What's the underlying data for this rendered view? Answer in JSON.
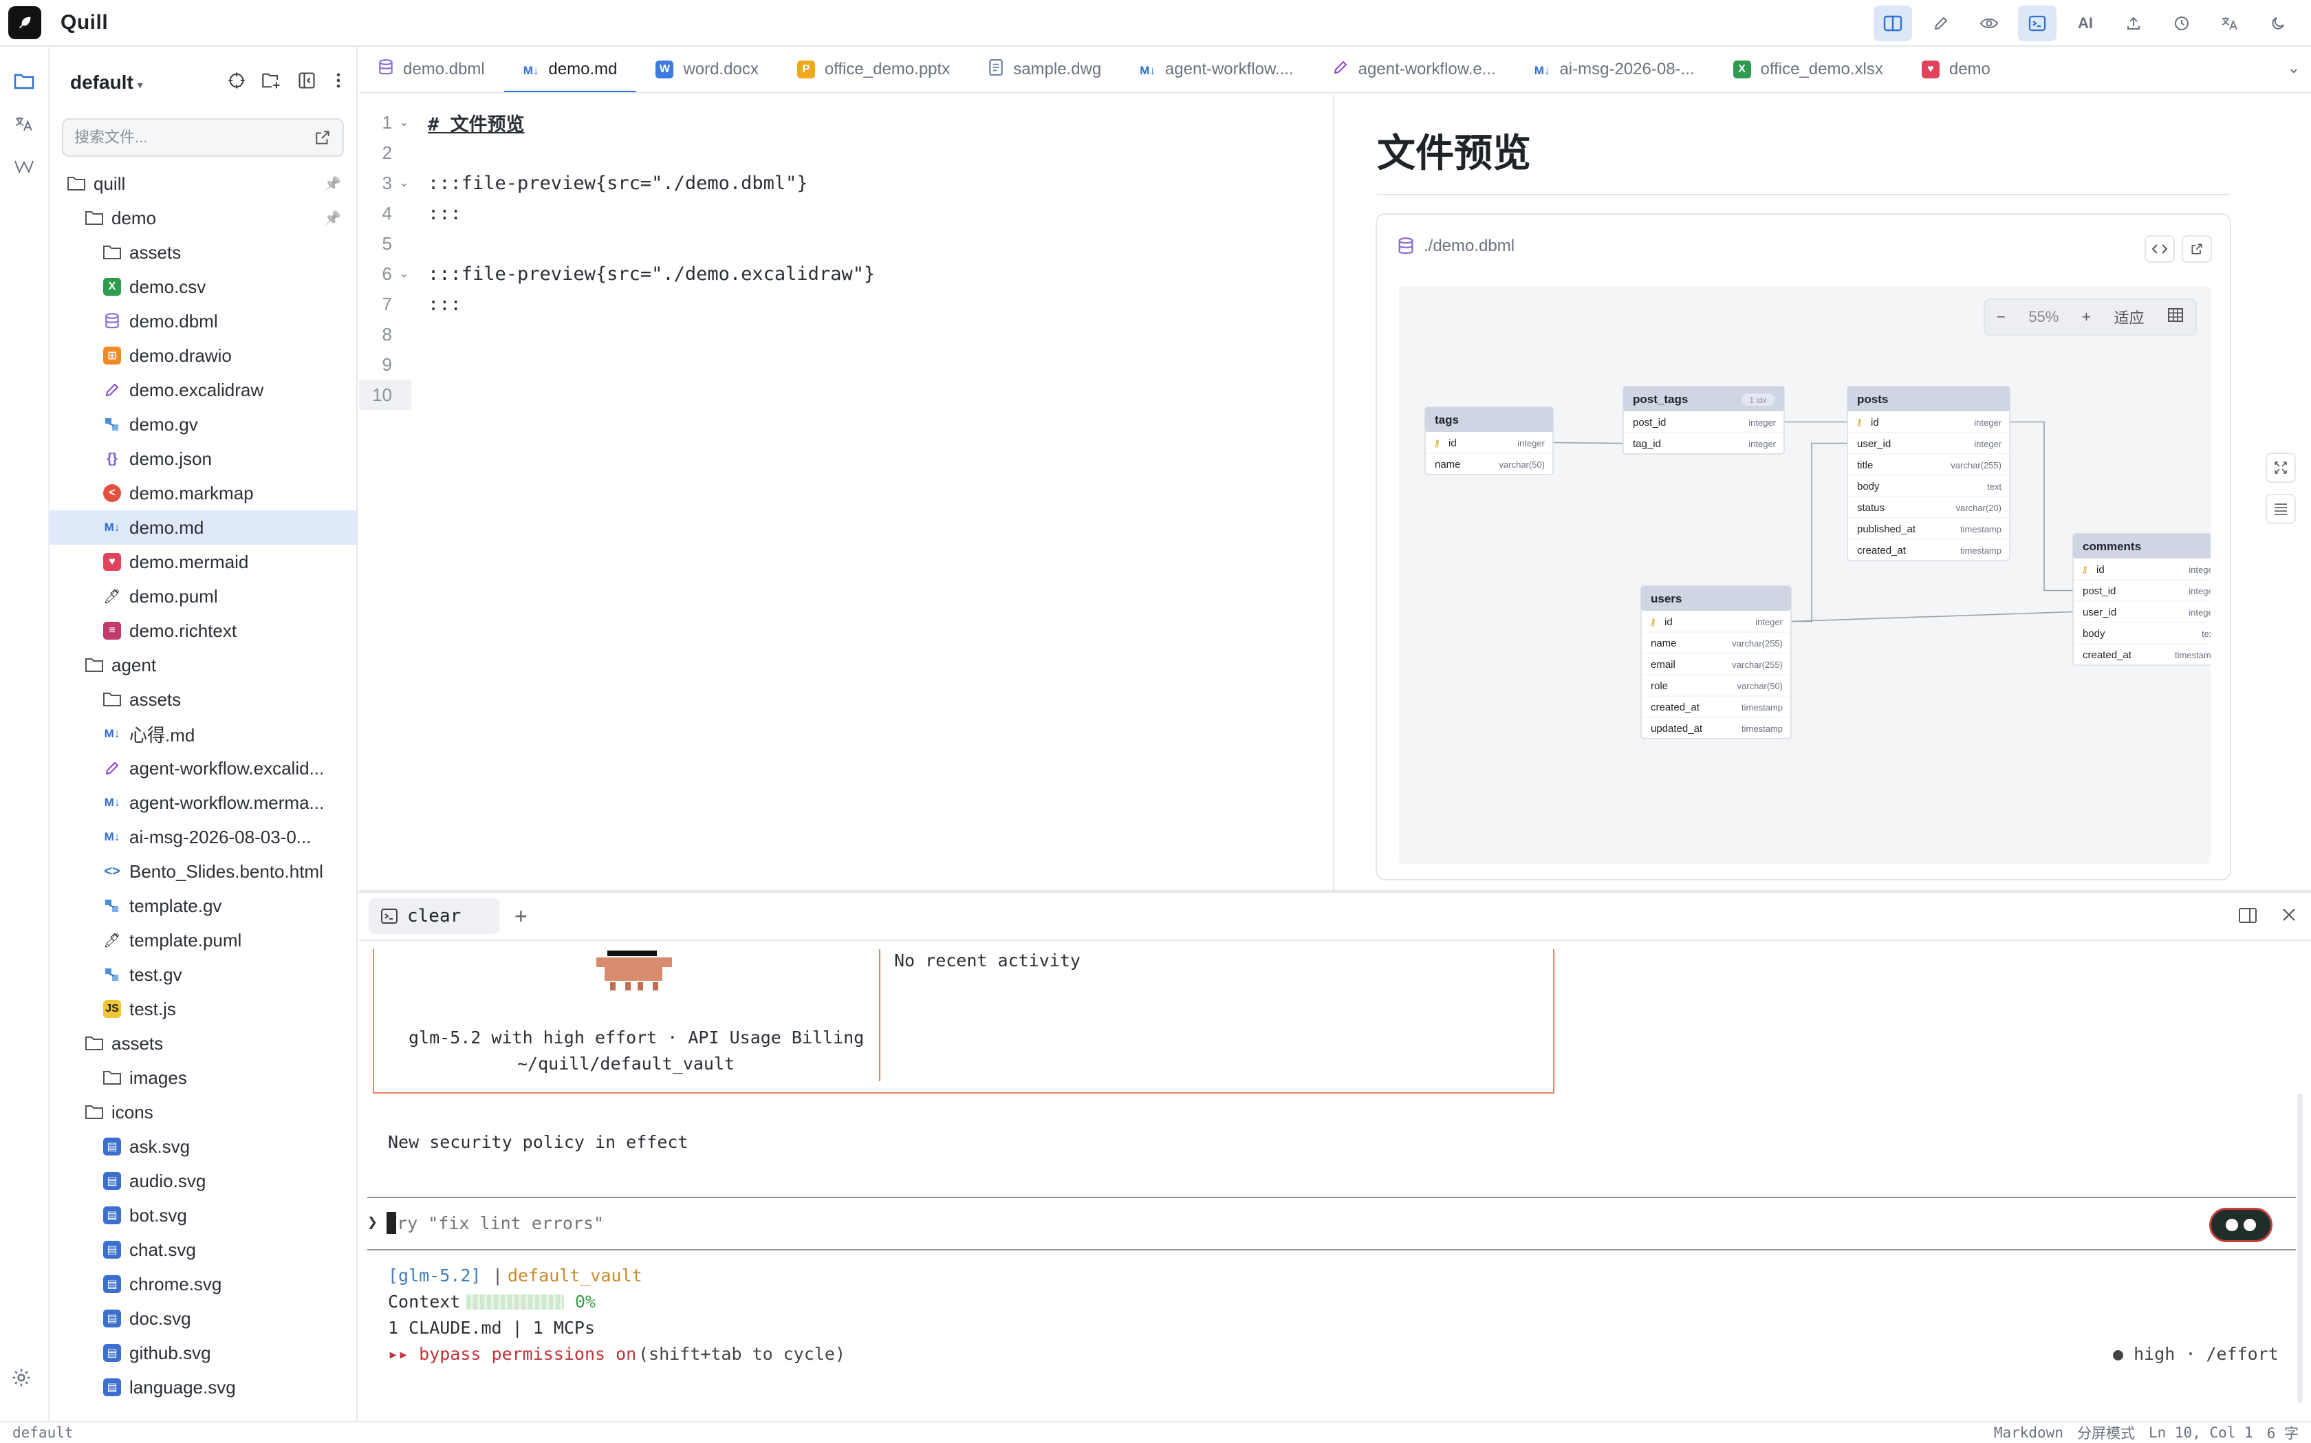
{
  "app": {
    "title": "Quill"
  },
  "sidebar": {
    "vault": "default",
    "search_placeholder": "搜索文件...",
    "tree": [
      {
        "label": "quill",
        "type": "folder",
        "depth": 0,
        "pinned": true
      },
      {
        "label": "demo",
        "type": "folder",
        "depth": 1,
        "pinned": true
      },
      {
        "label": "assets",
        "type": "folder",
        "depth": 2
      },
      {
        "label": "demo.csv",
        "type": "csv",
        "depth": 2
      },
      {
        "label": "demo.dbml",
        "type": "dbml",
        "depth": 2
      },
      {
        "label": "demo.drawio",
        "type": "drawio",
        "depth": 2
      },
      {
        "label": "demo.excalidraw",
        "type": "excalidraw",
        "depth": 2
      },
      {
        "label": "demo.gv",
        "type": "gv",
        "depth": 2
      },
      {
        "label": "demo.json",
        "type": "json",
        "depth": 2
      },
      {
        "label": "demo.markmap",
        "type": "markmap",
        "depth": 2
      },
      {
        "label": "demo.md",
        "type": "md",
        "depth": 2,
        "selected": true
      },
      {
        "label": "demo.mermaid",
        "type": "mermaid",
        "depth": 2
      },
      {
        "label": "demo.puml",
        "type": "puml",
        "depth": 2
      },
      {
        "label": "demo.richtext",
        "type": "richtext",
        "depth": 2
      },
      {
        "label": "agent",
        "type": "folder",
        "depth": 1
      },
      {
        "label": "assets",
        "type": "folder",
        "depth": 2
      },
      {
        "label": "心得.md",
        "type": "md",
        "depth": 2
      },
      {
        "label": "agent-workflow.excalid...",
        "type": "excalidraw",
        "depth": 2
      },
      {
        "label": "agent-workflow.merma...",
        "type": "md",
        "depth": 2
      },
      {
        "label": "ai-msg-2026-08-03-0...",
        "type": "md",
        "depth": 2
      },
      {
        "label": "Bento_Slides.bento.html",
        "type": "html",
        "depth": 2
      },
      {
        "label": "template.gv",
        "type": "gv",
        "depth": 2
      },
      {
        "label": "template.puml",
        "type": "puml",
        "depth": 2
      },
      {
        "label": "test.gv",
        "type": "gv",
        "depth": 2
      },
      {
        "label": "test.js",
        "type": "js",
        "depth": 2
      },
      {
        "label": "assets",
        "type": "folder",
        "depth": 1
      },
      {
        "label": "images",
        "type": "folder",
        "depth": 2
      },
      {
        "label": "icons",
        "type": "folder",
        "depth": 1
      },
      {
        "label": "ask.svg",
        "type": "svg",
        "depth": 2
      },
      {
        "label": "audio.svg",
        "type": "svg",
        "depth": 2
      },
      {
        "label": "bot.svg",
        "type": "svg",
        "depth": 2
      },
      {
        "label": "chat.svg",
        "type": "svg",
        "depth": 2
      },
      {
        "label": "chrome.svg",
        "type": "svg",
        "depth": 2
      },
      {
        "label": "doc.svg",
        "type": "svg",
        "depth": 2
      },
      {
        "label": "github.svg",
        "type": "svg",
        "depth": 2
      },
      {
        "label": "language.svg",
        "type": "svg",
        "depth": 2
      }
    ]
  },
  "tabs": [
    {
      "label": "demo.dbml",
      "type": "dbml"
    },
    {
      "label": "demo.md",
      "type": "md",
      "active": true
    },
    {
      "label": "word.docx",
      "type": "docx"
    },
    {
      "label": "office_demo.pptx",
      "type": "pptx"
    },
    {
      "label": "sample.dwg",
      "type": "dwg"
    },
    {
      "label": "agent-workflow....",
      "type": "md"
    },
    {
      "label": "agent-workflow.e...",
      "type": "excalidraw"
    },
    {
      "label": "ai-msg-2026-08-...",
      "type": "md"
    },
    {
      "label": "office_demo.xlsx",
      "type": "xlsx"
    },
    {
      "label": "demo",
      "type": "mermaid"
    }
  ],
  "editor": {
    "lines": [
      "# 文件预览",
      "",
      ":::file-preview{src=\"./demo.dbml\"}",
      ":::",
      "",
      ":::file-preview{src=\"./demo.excalidraw\"}",
      ":::",
      "",
      "",
      ""
    ],
    "line_numbers": [
      "1",
      "2",
      "3",
      "4",
      "5",
      "6",
      "7",
      "8",
      "9",
      "10"
    ],
    "folds": [
      "1",
      "3",
      "6"
    ]
  },
  "preview": {
    "title": "文件预览",
    "card_src": "./demo.dbml",
    "zoom": "55%",
    "fit_label": "适应",
    "diagram": {
      "tables": [
        {
          "name": "tags",
          "cols": [
            [
              "id",
              "integer",
              true
            ],
            [
              "name",
              "varchar(50)",
              false
            ]
          ]
        },
        {
          "name": "post_tags",
          "badge": "1 idx",
          "cols": [
            [
              "post_id",
              "integer",
              false
            ],
            [
              "tag_id",
              "integer",
              false
            ]
          ]
        },
        {
          "name": "posts",
          "cols": [
            [
              "id",
              "integer",
              true
            ],
            [
              "user_id",
              "integer",
              false
            ],
            [
              "title",
              "varchar(255)",
              false
            ],
            [
              "body",
              "text",
              false
            ],
            [
              "status",
              "varchar(20)",
              false
            ],
            [
              "published_at",
              "timestamp",
              false
            ],
            [
              "created_at",
              "timestamp",
              false
            ]
          ]
        },
        {
          "name": "users",
          "cols": [
            [
              "id",
              "integer",
              true
            ],
            [
              "name",
              "varchar(255)",
              false
            ],
            [
              "email",
              "varchar(255)",
              false
            ],
            [
              "role",
              "varchar(50)",
              false
            ],
            [
              "created_at",
              "timestamp",
              false
            ],
            [
              "updated_at",
              "timestamp",
              false
            ]
          ]
        },
        {
          "name": "comments",
          "cols": [
            [
              "id",
              "integer",
              true
            ],
            [
              "post_id",
              "integer",
              false
            ],
            [
              "user_id",
              "integer",
              false
            ],
            [
              "body",
              "text",
              false
            ],
            [
              "created_at",
              "timestamp",
              false
            ]
          ]
        }
      ]
    }
  },
  "terminal": {
    "tab_label": "clear",
    "recent": "No recent activity",
    "model_line": "glm-5.2 with high effort · API Usage Billing",
    "path_line": "~/quill/default_vault",
    "notice": "New security policy in effect",
    "prompt_placeholder": "Try \"fix lint errors\"",
    "status_model": "[glm-5.2]",
    "status_vault": "default_vault",
    "context_label": "Context",
    "context_pct": "0%",
    "claude_line": "1 CLAUDE.md | 1 MCPs",
    "bypass_on": "▸▸ bypass permissions on",
    "bypass_hint": "(shift+tab to cycle)",
    "effort": "● high · /effort"
  },
  "statusbar": {
    "left": "default",
    "lang": "Markdown",
    "mode": "分屏模式",
    "pos": "Ln 10, Col 1",
    "count": "6 字"
  },
  "header_ai_label": "AI",
  "colors": {
    "accent": "#2f6fd1",
    "selection": "#dfe9f9",
    "terminal_border": "#e0876a"
  }
}
